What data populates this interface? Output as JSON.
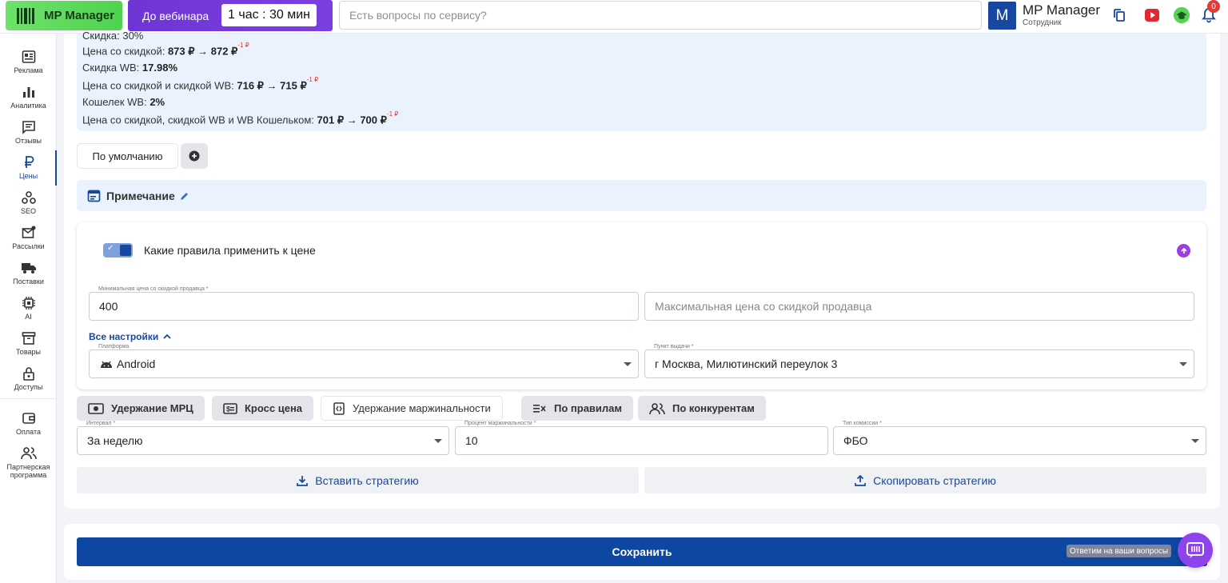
{
  "topbar": {
    "logo_label": "MP Manager",
    "webinar_label": "До вебинара",
    "webinar_timer": "1 час : 30 мин",
    "search_placeholder": "Есть вопросы по сервису?",
    "user_initial": "M",
    "user_name": "MP Manager",
    "user_role": "Сотрудник",
    "notifications_count": "0"
  },
  "sidebar": {
    "items": [
      {
        "label": "Реклама",
        "icon": "ads-icon"
      },
      {
        "label": "Аналитика",
        "icon": "analytics-icon"
      },
      {
        "label": "Отзывы",
        "icon": "reviews-icon"
      },
      {
        "label": "Цены",
        "icon": "ruble-icon"
      },
      {
        "label": "SEO",
        "icon": "seo-icon"
      },
      {
        "label": "Рассылки",
        "icon": "mail-icon"
      },
      {
        "label": "Поставки",
        "icon": "truck-icon"
      },
      {
        "label": "AI",
        "icon": "chip-icon"
      },
      {
        "label": "Товары",
        "icon": "box-icon"
      },
      {
        "label": "Доступы",
        "icon": "lock-icon"
      },
      {
        "label": "Оплата",
        "icon": "wallet-icon"
      },
      {
        "label": "Партнерская программа",
        "icon": "partners-icon"
      }
    ],
    "active": "Цены"
  },
  "info": {
    "discount_partial": "Скидка: 30%",
    "price_discount_label": "Цена со скидкой:",
    "price_discount_value": "873 ₽ → 872 ₽",
    "price_discount_delta": "-1 ₽",
    "wb_discount_label": "Скидка WB:",
    "wb_discount_value": "17.98%",
    "price_wb_label": "Цена со скидкой и скидкой WB:",
    "price_wb_value": "716 ₽ → 715 ₽",
    "price_wb_delta": "-1 ₽",
    "wallet_label": "Кошелек WB:",
    "wallet_value": "2%",
    "price_wallet_label": "Цена со скидкой, скидкой WB и WB Кошельком:",
    "price_wallet_value": "701 ₽ → 700 ₽",
    "price_wallet_delta": "-1 ₽"
  },
  "presets": {
    "default_label": "По умолчанию"
  },
  "note": {
    "label": "Примечание"
  },
  "rules": {
    "title": "Какие правила применить к цене",
    "min_price_label": "Минимальная цена со скидкой продавца *",
    "min_price_value": "400",
    "max_price_placeholder": "Максимальная цена со скидкой продавца",
    "all_settings": "Все настройки",
    "platform_label": "Платформа",
    "platform_value": "Android",
    "pickup_label": "Пункт выдачи *",
    "pickup_value": "г Москва, Милютинский переулок 3"
  },
  "strategies": {
    "tabs": [
      "Удержание МРЦ",
      "Кросс цена",
      "Удержание маржинальности",
      "По правилам",
      "По конкурентам"
    ],
    "active": "Удержание маржинальности",
    "interval_label": "Интервал *",
    "interval_value": "За неделю",
    "margin_label": "Процент маржинальности *",
    "margin_value": "10",
    "commission_label": "Тип комиссии *",
    "commission_value": "ФБО",
    "paste_label": "Вставить стратегию",
    "copy_label": "Скопировать стратегию"
  },
  "footer": {
    "save_label": "Сохранить",
    "help_tooltip": "Ответим на ваши вопросы"
  },
  "colors": {
    "brand": "#17479e",
    "save": "#0d47a1",
    "accent_purple": "#8e44ec",
    "green": "#4fd251",
    "info_bg": "#eaf3fd"
  }
}
